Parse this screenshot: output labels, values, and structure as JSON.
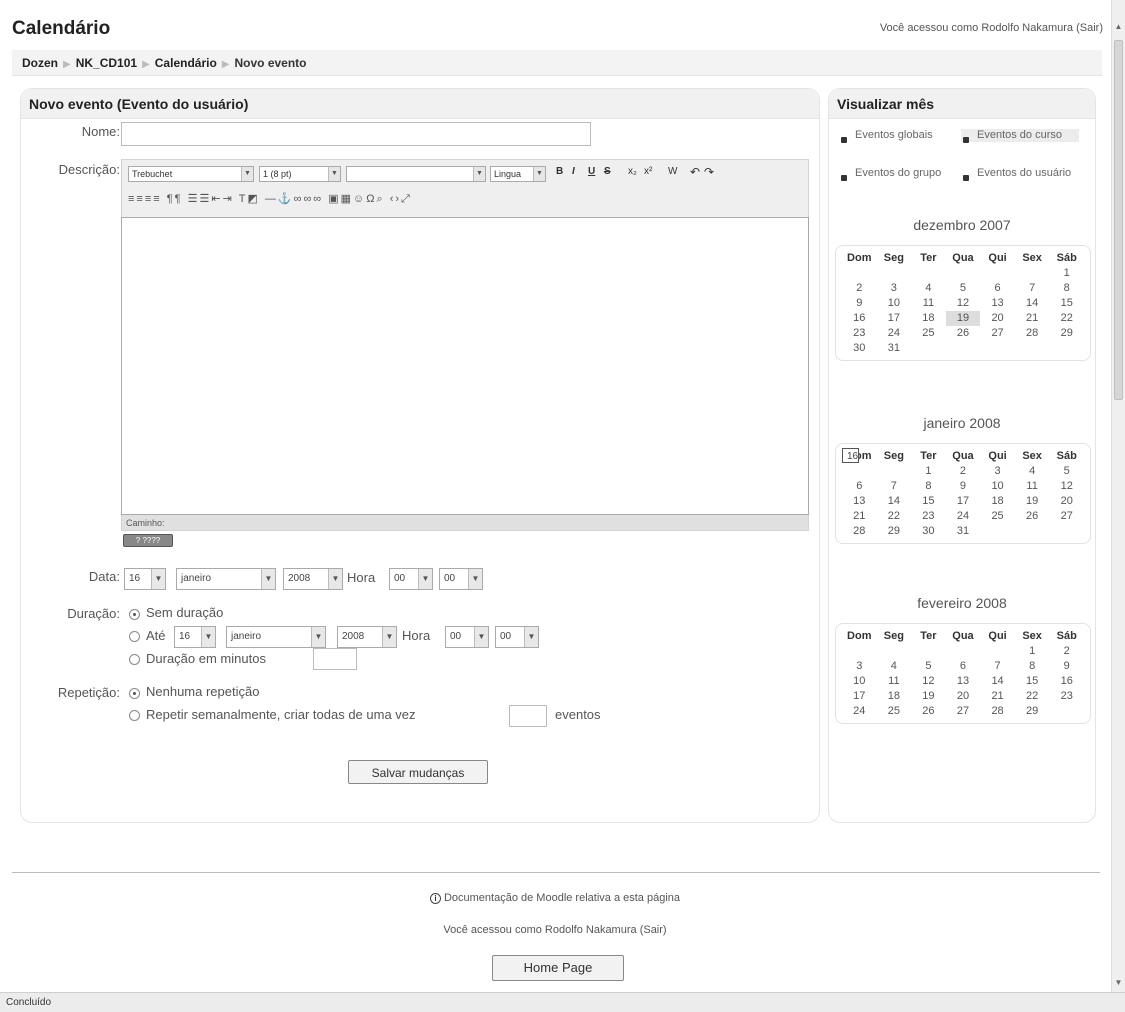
{
  "header": {
    "title": "Calendário",
    "login_text": "Você acessou como Rodolfo Nakamura",
    "logout": "(Sair)"
  },
  "breadcrumb": {
    "items": [
      "Dozen",
      "NK_CD101",
      "Calendário",
      "Novo evento"
    ]
  },
  "form": {
    "panel_title": "Novo evento (Evento do usuário)",
    "name_label": "Nome:",
    "name_value": "",
    "description_label": "Descrição:",
    "editor": {
      "font": "Trebuchet",
      "size": "1 (8 pt)",
      "style": "",
      "lang": "Lingua",
      "path_label": "Caminho:",
      "badge": "? ????"
    },
    "date_label": "Data:",
    "date": {
      "day": "16",
      "month": "janeiro",
      "year": "2008",
      "hour_label": "Hora",
      "hour": "00",
      "minute": "00"
    },
    "duration_label": "Duração:",
    "duration_options": {
      "none": "Sem duração",
      "until": "Até",
      "minutes": "Duração em minutos"
    },
    "until": {
      "day": "16",
      "month": "janeiro",
      "year": "2008",
      "hour_label": "Hora",
      "hour": "00",
      "minute": "00"
    },
    "minutes_value": "",
    "repeat_label": "Repetição:",
    "repeat_options": {
      "none": "Nenhuma repetição",
      "weekly": "Repetir semanalmente, criar todas de uma vez",
      "events_suffix": "eventos"
    },
    "repeat_count": "",
    "save_button": "Salvar mudanças"
  },
  "sidebar": {
    "title": "Visualizar mês",
    "legend": {
      "global": "Eventos globais",
      "course": "Eventos do curso",
      "group": "Eventos do grupo",
      "user": "Eventos do usuário"
    },
    "weekdays": [
      "Dom",
      "Seg",
      "Ter",
      "Qua",
      "Qui",
      "Sex",
      "Sáb"
    ],
    "months": [
      {
        "title": "dezembro 2007",
        "offset": 6,
        "days": 31,
        "today": 19,
        "selected": null
      },
      {
        "title": "janeiro 2008",
        "offset": 2,
        "days": 31,
        "today": null,
        "selected": 16
      },
      {
        "title": "fevereiro 2008",
        "offset": 5,
        "days": 29,
        "today": null,
        "selected": null
      }
    ]
  },
  "footer": {
    "doc_link": "Documentação de Moodle relativa a esta página",
    "login_text": "Você acessou como Rodolfo Nakamura",
    "logout": "(Sair)",
    "home_button": "Home Page"
  },
  "statusbar": {
    "text": "Concluído"
  }
}
